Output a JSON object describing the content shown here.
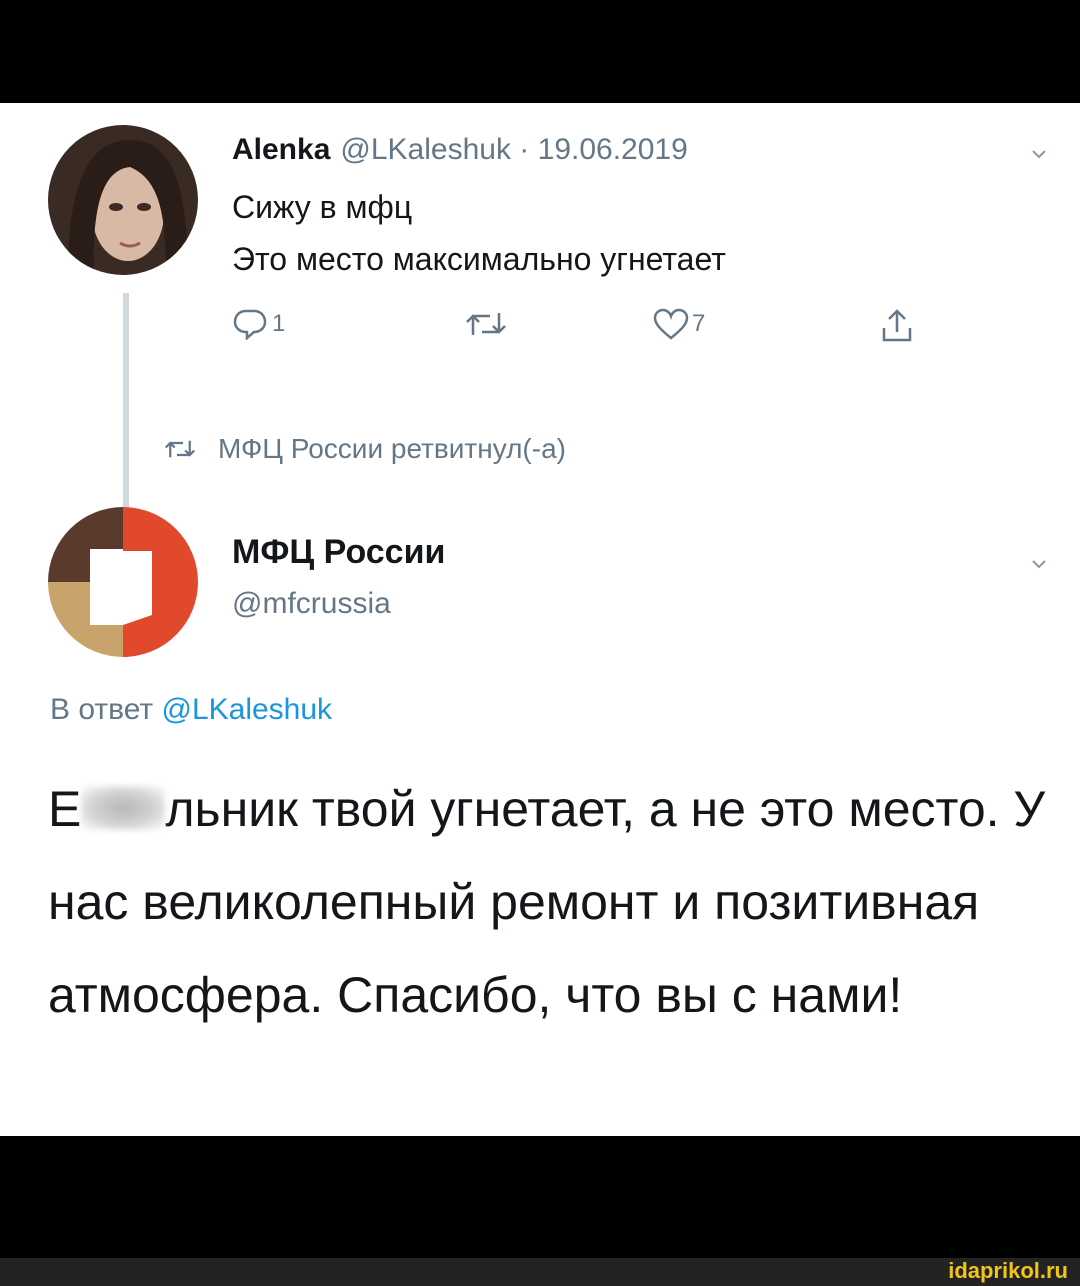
{
  "tweet1": {
    "name": "Alenka",
    "handle": "@LKaleshuk",
    "separator": "·",
    "date": "19.06.2019",
    "lines": [
      "Сижу в мфц",
      "Это место максимально угнетает"
    ],
    "actions": {
      "reply_icon": "reply-icon",
      "reply_count": "1",
      "retweet_icon": "retweet-icon",
      "retweet_count": "",
      "like_icon": "heart-icon",
      "like_count": "7",
      "share_icon": "share-icon"
    }
  },
  "retweet_notice": {
    "icon": "retweet-icon",
    "text": "МФЦ России ретвитнул(-а)"
  },
  "tweet2": {
    "name": "МФЦ России",
    "handle": "@mfcrussia",
    "reply_prefix": "В ответ",
    "reply_mention": "@LKaleshuk",
    "text_start": "Е",
    "text_rest": "льник твой угнетает, а не это место. У нас великолепный ремонт и позитивная атмосфера. Спасибо, что вы с нами!"
  },
  "colors": {
    "secondary_text": "#657786",
    "link": "#1b95e0",
    "primary_text": "#14171a",
    "logo_dark_brown": "#5a3a2c",
    "logo_tan": "#c9a36c",
    "logo_orange_red": "#e0492b"
  },
  "watermark": "idaprikol.ru"
}
